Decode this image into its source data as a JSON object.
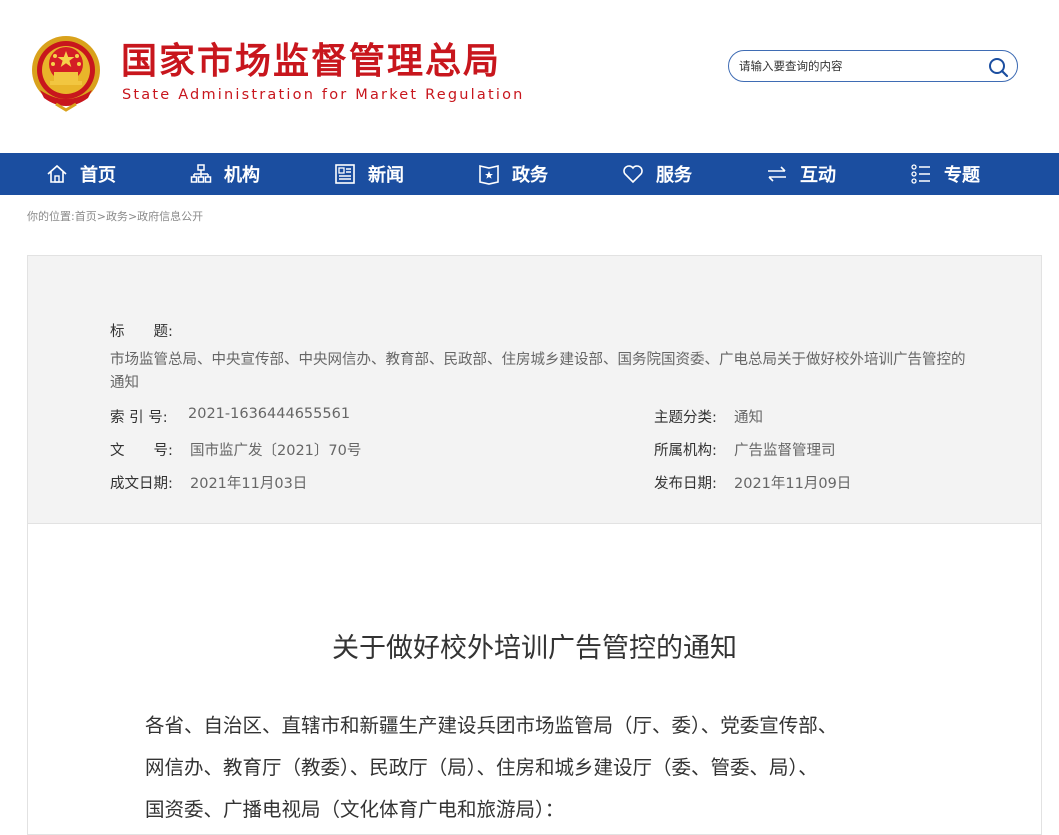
{
  "header": {
    "title_cn": "国家市场监督管理总局",
    "title_en": "State Administration for Market Regulation",
    "emblem_icon": "national-emblem-icon",
    "brand_color": "#c8161d"
  },
  "search": {
    "placeholder": "请输入要查询的内容",
    "icon": "search-icon"
  },
  "nav": {
    "bg_color": "#1b4ea0",
    "items": [
      {
        "label": "首页",
        "icon": "home-icon"
      },
      {
        "label": "机构",
        "icon": "org-chart-icon"
      },
      {
        "label": "新闻",
        "icon": "news-icon"
      },
      {
        "label": "政务",
        "icon": "government-icon"
      },
      {
        "label": "服务",
        "icon": "heart-icon"
      },
      {
        "label": "互动",
        "icon": "exchange-icon"
      },
      {
        "label": "专题",
        "icon": "topic-list-icon"
      }
    ]
  },
  "breadcrumb": {
    "prefix": "你的位置:",
    "items": [
      "首页",
      "政务",
      "政府信息公开"
    ],
    "separator": ">"
  },
  "meta": {
    "title_label": "标　　题:",
    "title_value": "市场监管总局、中央宣传部、中央网信办、教育部、民政部、住房城乡建设部、国务院国资委、广电总局关于做好校外培训广告管控的通知",
    "index_label": "索 引 号:",
    "index_value": "2021-1636444655561",
    "category_label": "主题分类:",
    "category_value": "通知",
    "docno_label": "文　　号:",
    "docno_value": "国市监广发〔2021〕70号",
    "dept_label": "所属机构:",
    "dept_value": "广告监督管理司",
    "created_label": "成文日期:",
    "created_value": "2021年11月03日",
    "published_label": "发布日期:",
    "published_value": "2021年11月09日"
  },
  "document": {
    "title": "关于做好校外培训广告管控的通知",
    "body_lines": [
      "各省、自治区、直辖市和新疆生产建设兵团市场监管局（厅、委）、党委宣传部、",
      "网信办、教育厅（教委）、民政厅（局）、住房和城乡建设厅（委、管委、局）、",
      "国资委、广播电视局（文化体育广电和旅游局）："
    ]
  }
}
